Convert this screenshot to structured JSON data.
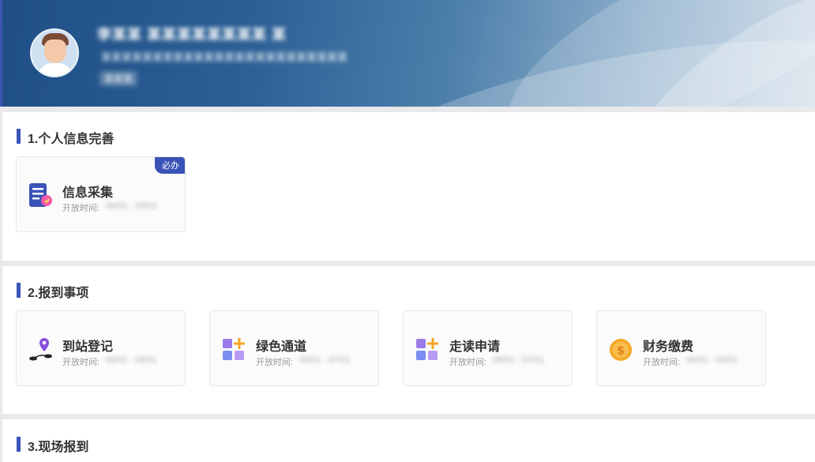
{
  "header": {
    "user_name": "李某某 某某某某某某某某 某",
    "user_sub": "某某某某某某某某某某某某某某某某某某某某某某某某",
    "user_tag": "某某某"
  },
  "sections": [
    {
      "title": "1.个人信息完善",
      "cards": [
        {
          "name": "信息采集",
          "time_label": "开放时间:",
          "time_value": "06/01 - 09/01",
          "badge": "必办",
          "icon": "document-form-icon"
        }
      ]
    },
    {
      "title": "2.报到事项",
      "cards": [
        {
          "name": "到站登记",
          "time_label": "开放时间:",
          "time_value": "06/01 - 09/01",
          "icon": "location-route-icon"
        },
        {
          "name": "绿色通道",
          "time_label": "开放时间:",
          "time_value": "06/01 - 07/01",
          "icon": "apps-plus-icon"
        },
        {
          "name": "走读申请",
          "time_label": "开放时间:",
          "time_value": "06/01 - 07/01",
          "icon": "apps-plus-icon"
        },
        {
          "name": "财务缴费",
          "time_label": "开放时间:",
          "time_value": "06/01 - 09/01",
          "icon": "coin-icon"
        }
      ]
    },
    {
      "title": "3.现场报到",
      "cards": []
    }
  ],
  "colors": {
    "accent": "#3a53b6",
    "banner_dark": "#1f4f86",
    "banner_light": "#c9d8e6"
  }
}
